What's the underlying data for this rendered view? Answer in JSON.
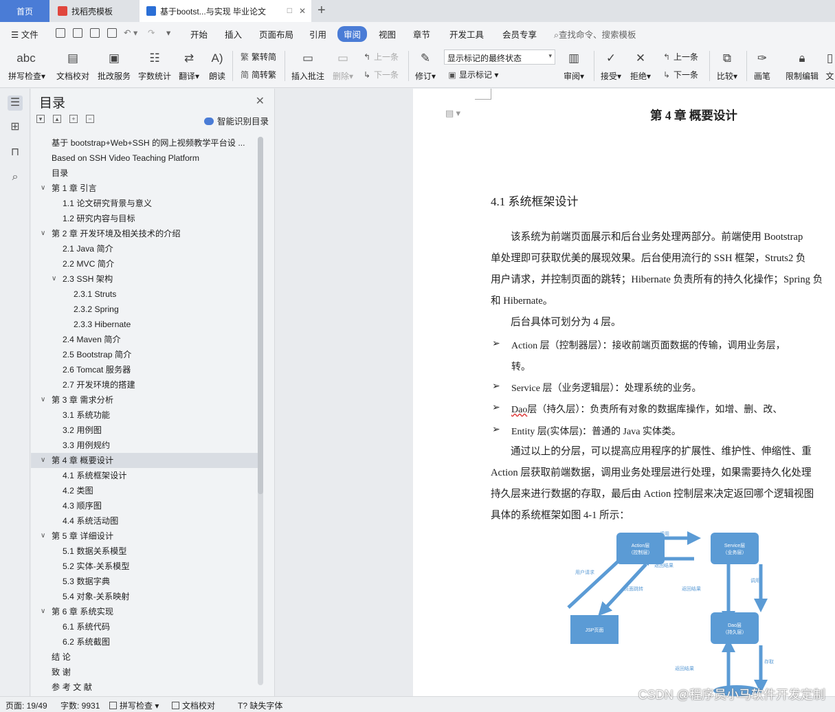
{
  "tabs": {
    "home": "首页",
    "template": "找稻壳模板",
    "document": "基于bootst...与实现 毕业论文"
  },
  "menu": {
    "file": "文件",
    "items": [
      "开始",
      "插入",
      "页面布局",
      "引用",
      "审阅",
      "视图",
      "章节",
      "开发工具",
      "会员专享"
    ],
    "search": "查找命令、搜索模板"
  },
  "ribbon": {
    "spellcheck": "拼写检查",
    "doccheck": "文档校对",
    "batch": "批改服务",
    "wordcount": "字数统计",
    "translate": "翻译",
    "read": "朗读",
    "to_trad": "繁转简",
    "to_simp": "简转繁",
    "insert_comment": "插入批注",
    "delete": "删除",
    "prev": "上一条",
    "next": "下一条",
    "revise": "修订",
    "markup_state": "显示标记的最终状态",
    "show_markup": "显示标记",
    "review": "审阅",
    "accept": "接受",
    "reject": "拒绝",
    "prev2": "上一条",
    "next2": "下一条",
    "compare": "比较",
    "pen": "画笔",
    "restrict": "限制编辑",
    "doc_cut": "文"
  },
  "toc": {
    "title": "目录",
    "smart": "智能识别目录",
    "items": [
      {
        "text": "基于 bootstrap+Web+SSH 的网上视频教学平台设 ...",
        "level": 0,
        "chev": ""
      },
      {
        "text": "Based on SSH Video Teaching Platform",
        "level": 0,
        "chev": ""
      },
      {
        "text": "目录",
        "level": 0,
        "chev": ""
      },
      {
        "text": "第 1 章  引言",
        "level": 0,
        "chev": "v"
      },
      {
        "text": "1.1  论文研究背景与意义",
        "level": 1,
        "chev": ""
      },
      {
        "text": "1.2  研究内容与目标",
        "level": 1,
        "chev": ""
      },
      {
        "text": "第 2 章  开发环境及相关技术的介绍",
        "level": 0,
        "chev": "v"
      },
      {
        "text": "2.1 Java 简介",
        "level": 1,
        "chev": ""
      },
      {
        "text": "2.2 MVC 简介",
        "level": 1,
        "chev": ""
      },
      {
        "text": "2.3 SSH 架构",
        "level": 1,
        "chev": "v"
      },
      {
        "text": "2.3.1 Struts",
        "level": 2,
        "chev": ""
      },
      {
        "text": "2.3.2 Spring",
        "level": 2,
        "chev": ""
      },
      {
        "text": "2.3.3 Hibernate",
        "level": 2,
        "chev": ""
      },
      {
        "text": "2.4 Maven 简介",
        "level": 1,
        "chev": ""
      },
      {
        "text": "2.5 Bootstrap 简介",
        "level": 1,
        "chev": ""
      },
      {
        "text": "2.6 Tomcat 服务器",
        "level": 1,
        "chev": ""
      },
      {
        "text": "2.7  开发环境的搭建",
        "level": 1,
        "chev": ""
      },
      {
        "text": "第 3 章  需求分析",
        "level": 0,
        "chev": "v"
      },
      {
        "text": "3.1  系统功能",
        "level": 1,
        "chev": ""
      },
      {
        "text": "3.2  用例图",
        "level": 1,
        "chev": ""
      },
      {
        "text": "3.3  用例规约",
        "level": 1,
        "chev": ""
      },
      {
        "text": "第 4 章  概要设计",
        "level": 0,
        "chev": "v",
        "selected": true
      },
      {
        "text": "4.1  系统框架设计",
        "level": 1,
        "chev": ""
      },
      {
        "text": "4.2  类图",
        "level": 1,
        "chev": ""
      },
      {
        "text": "4.3  顺序图",
        "level": 1,
        "chev": ""
      },
      {
        "text": "4.4  系统活动图",
        "level": 1,
        "chev": ""
      },
      {
        "text": "第 5 章  详细设计",
        "level": 0,
        "chev": "v"
      },
      {
        "text": "5.1  数据关系模型",
        "level": 1,
        "chev": ""
      },
      {
        "text": "5.2  实体-关系模型",
        "level": 1,
        "chev": ""
      },
      {
        "text": "5.3  数据字典",
        "level": 1,
        "chev": ""
      },
      {
        "text": "5.4  对象-关系映射",
        "level": 1,
        "chev": ""
      },
      {
        "text": "第 6 章  系统实现",
        "level": 0,
        "chev": "v"
      },
      {
        "text": "6.1  系统代码",
        "level": 1,
        "chev": ""
      },
      {
        "text": "6.2  系统截图",
        "level": 1,
        "chev": ""
      },
      {
        "text": "结   论",
        "level": 0,
        "chev": ""
      },
      {
        "text": "致   谢",
        "level": 0,
        "chev": ""
      },
      {
        "text": "参 考 文 献",
        "level": 0,
        "chev": ""
      }
    ]
  },
  "doc": {
    "chapter": "第 4 章  概要设计",
    "section": "4.1   系统框架设计",
    "p1": [
      "该系统为前端页面展示和后台业务处理两部分。前端使用 Bootstrap",
      "单处理即可获取优美的展现效果。后台使用流行的 SSH 框架，Struts2 负",
      "用户请求，并控制页面的跳转；Hibernate 负责所有的持久化操作；Spring 负",
      "和 Hibernate。"
    ],
    "p2": "后台具体可划分为 4 层。",
    "bullets": [
      {
        "text": "Action 层（控制器层）：接收前端页面数据的传输，调用业务层，"
      },
      {
        "text": "转。",
        "cont": true
      },
      {
        "text": "Service 层（业务逻辑层）：处理系统的业务。"
      },
      {
        "text": "层（持久层）：负责所有对象的数据库操作，如增、删、改、",
        "lead": "Dao"
      },
      {
        "text": "Entity 层(实体层)：普通的 Java 实体类。"
      }
    ],
    "p3": [
      "通过以上的分层，可以提高应用程序的扩展性、维护性、伸缩性、重",
      "Action 层获取前端数据，调用业务处理层进行处理，如果需要持久化处理",
      "持久层来进行数据的存取，最后由 Action 控制层来决定返回哪个逻辑视图",
      "具体的系统框架如图 4-1 所示："
    ],
    "diagram": {
      "action": [
        "Action层",
        "（控制层）"
      ],
      "service": [
        "Service层",
        "（业务层）"
      ],
      "jsp": "JSP页面",
      "dao": [
        "Dao层",
        "（持久层）"
      ],
      "call1": "调用",
      "ret1": "返回结果",
      "user_req": "用户请求",
      "page_jump": "页面跳转",
      "ret2": "返回结果",
      "call2": "调用",
      "ret3": "返回结果",
      "store": "存取"
    }
  },
  "status": {
    "page": "页面: 19/49",
    "words": "字数: 9931",
    "spell": "拼写检查",
    "doccheck": "文档校对",
    "missing_font": "缺失字体",
    "watermark": "CSDN @程序员小马软件开发定制"
  },
  "colors": {
    "accent": "#4a7cd6",
    "diagram_box": "#5b9bd5"
  }
}
